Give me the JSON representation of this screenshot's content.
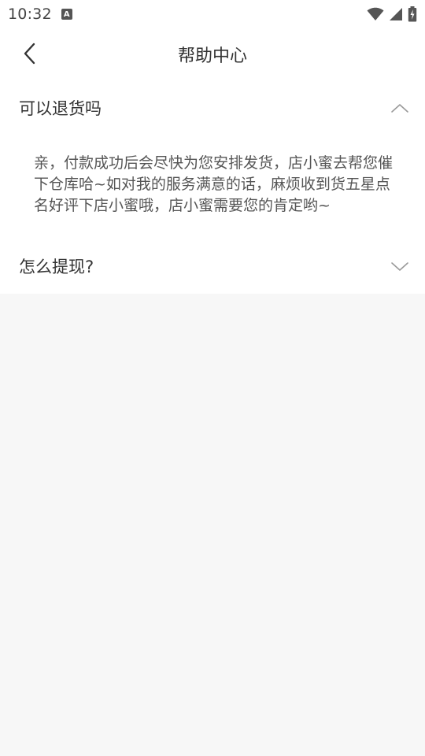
{
  "status_bar": {
    "time": "10:32",
    "notification_icon": "a-icon",
    "icons": [
      "wifi-icon",
      "signal-icon",
      "battery-charging-icon"
    ]
  },
  "nav": {
    "back_icon": "chevron-left-icon",
    "title": "帮助中心"
  },
  "faq": [
    {
      "question": "可以退货吗",
      "expanded": true,
      "answer": "亲，付款成功后会尽快为您安排发货，店小蜜去帮您催下仓库哈~如对我的服务满意的话，麻烦收到货五星点名好评下店小蜜哦，店小蜜需要您的肯定哟~"
    },
    {
      "question": "怎么提现?",
      "expanded": false
    }
  ],
  "colors": {
    "background": "#f7f7f7",
    "surface": "#ffffff",
    "text_primary": "#333333",
    "text_secondary": "#555555",
    "chevron": "#9a9a9a"
  }
}
